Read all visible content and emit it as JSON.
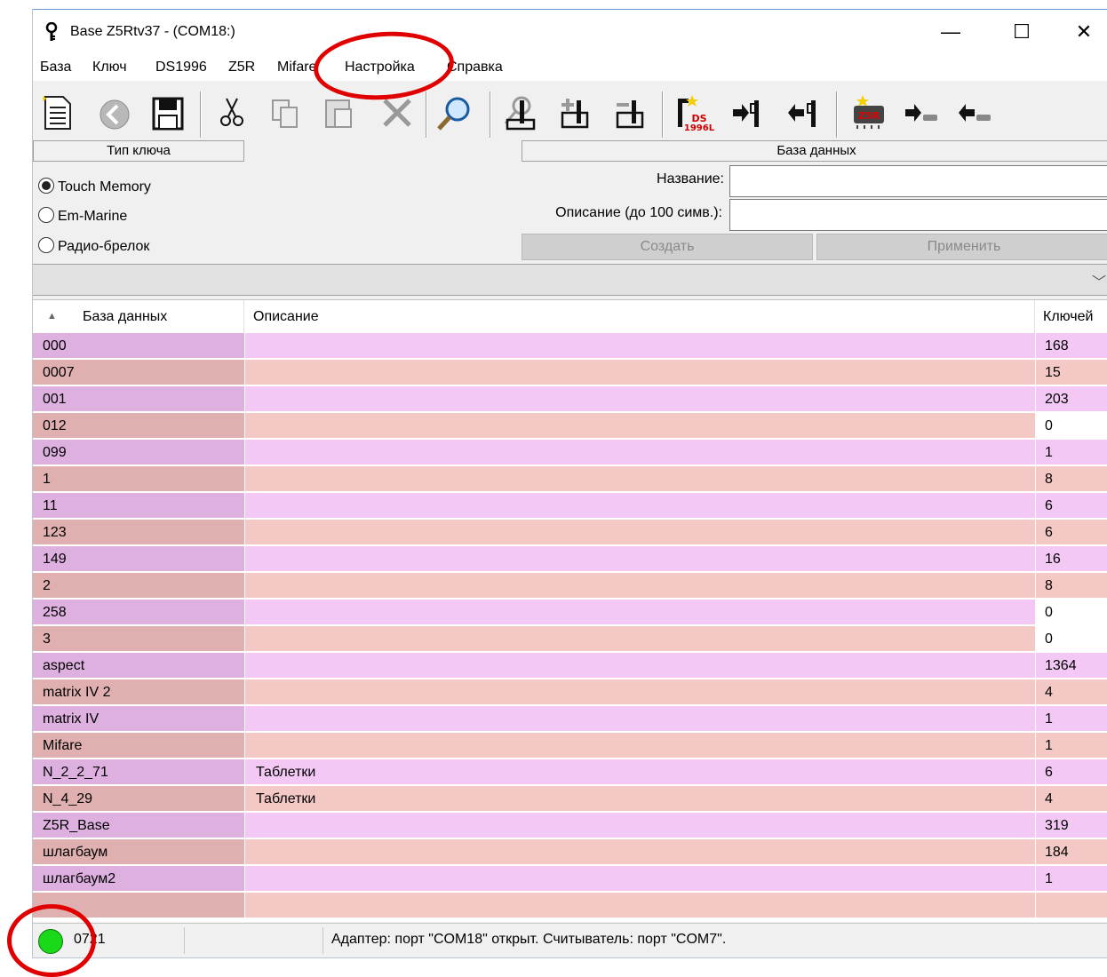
{
  "window": {
    "title": "Base Z5Rtv37 - (COM18:)",
    "controls": {
      "minimize": "—",
      "maximize": "☐",
      "close": "✕"
    }
  },
  "menu": [
    "База",
    "Ключ",
    "DS1996",
    "Z5R",
    "Mifare",
    "Настройка",
    "Справка"
  ],
  "toolbar": {
    "icons": [
      "new-document-icon",
      "back-icon",
      "save-icon",
      "cut-icon",
      "copy-icon",
      "paste-icon",
      "delete-icon",
      "search-icon",
      "find-key-icon",
      "add-key-icon",
      "remove-key-icon",
      "ds1996l-icon",
      "import-arrow-icon",
      "export-arrow-icon",
      "z5r-chip-icon",
      "chip-import-icon",
      "chip-export-icon"
    ],
    "ds_label_top": "DS",
    "ds_label_bottom": "1996L",
    "z5r_label": "Z5R"
  },
  "key_type": {
    "header": "Тип ключа",
    "options": [
      "Touch Memory",
      "Em-Marine",
      "Радио-брелок"
    ],
    "selected": 0
  },
  "database_panel": {
    "header": "База данных",
    "name_label": "Название:",
    "name_value": "",
    "desc_label": "Описание (до 100 симв.):",
    "desc_value": "",
    "create_button": "Создать",
    "apply_button": "Применить"
  },
  "combo": {
    "chevron": "﹀"
  },
  "table": {
    "sort_indicator": "▲",
    "columns": [
      "База данных",
      "Описание",
      "Ключей"
    ],
    "rows": [
      {
        "name": "000",
        "desc": "",
        "keys": "168"
      },
      {
        "name": "0007",
        "desc": "",
        "keys": "15"
      },
      {
        "name": "001",
        "desc": "",
        "keys": "203"
      },
      {
        "name": "012",
        "desc": "",
        "keys": "0"
      },
      {
        "name": "099",
        "desc": "",
        "keys": "1"
      },
      {
        "name": "1",
        "desc": "",
        "keys": "8"
      },
      {
        "name": "11",
        "desc": "",
        "keys": "6"
      },
      {
        "name": "123",
        "desc": "",
        "keys": "6"
      },
      {
        "name": "149",
        "desc": "",
        "keys": "16"
      },
      {
        "name": "2",
        "desc": "",
        "keys": "8"
      },
      {
        "name": "258",
        "desc": "",
        "keys": "0"
      },
      {
        "name": "3",
        "desc": "",
        "keys": "0"
      },
      {
        "name": "aspect",
        "desc": "",
        "keys": "1364"
      },
      {
        "name": "matrix IV 2",
        "desc": "",
        "keys": "4"
      },
      {
        "name": "matrix IV",
        "desc": "",
        "keys": "1"
      },
      {
        "name": "Mifare",
        "desc": "",
        "keys": "1"
      },
      {
        "name": "N_2_2_71",
        "desc": "Таблетки",
        "keys": "6"
      },
      {
        "name": "N_4_29",
        "desc": "Таблетки",
        "keys": "4"
      },
      {
        "name": "Z5R_Base",
        "desc": "",
        "keys": "319"
      },
      {
        "name": "шлагбаум",
        "desc": "",
        "keys": "184"
      },
      {
        "name": "шлагбаум2",
        "desc": "",
        "keys": "1"
      },
      {
        "name": "",
        "desc": "",
        "keys": ""
      }
    ]
  },
  "status": {
    "count": "0721",
    "message": "Адаптер: порт \"COM18\" открыт. Считыватель: порт \"COM7\"."
  },
  "colors": {
    "row_even_c1": "#deb0e0",
    "row_even_rest": "#f4c8f4",
    "row_odd_c1": "#e0b0b0",
    "row_odd_rest": "#f4c8c4",
    "zero_keys_bg": "#ffffff",
    "led": "#19d919",
    "annotation": "#e00000"
  }
}
